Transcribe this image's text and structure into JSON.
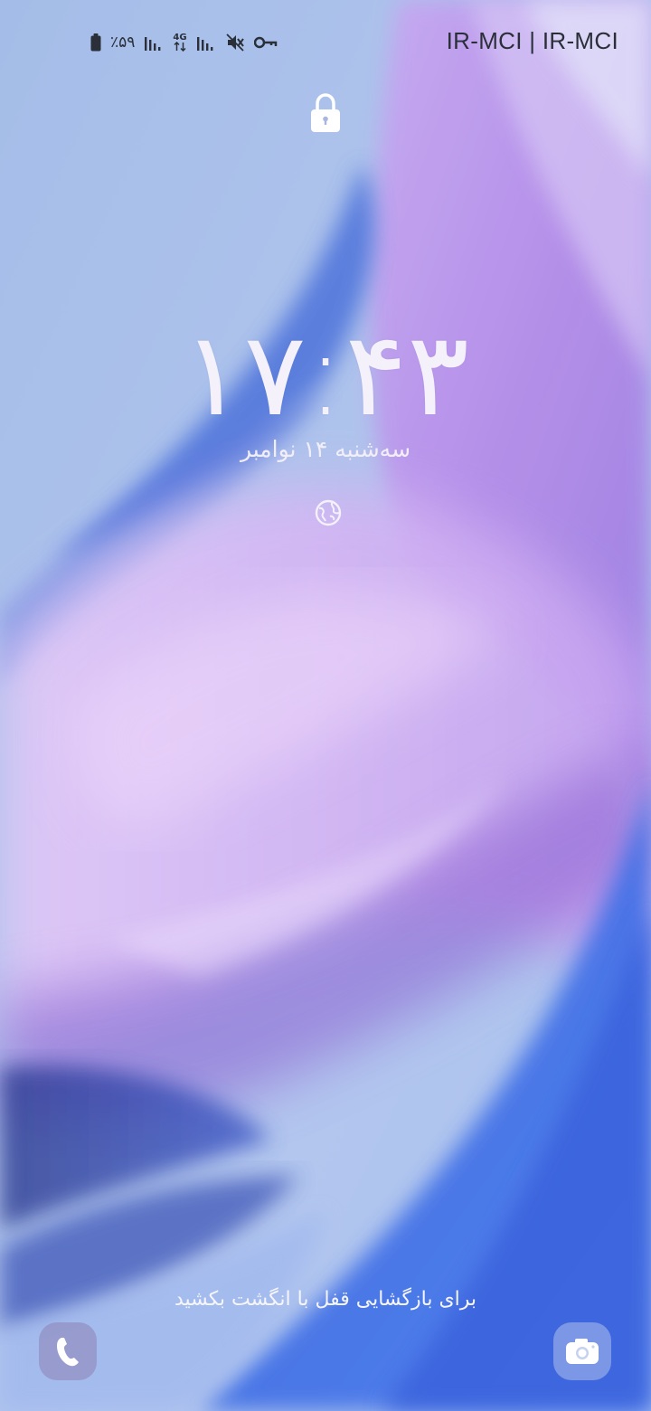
{
  "status_bar": {
    "battery_percent": "٪۵۹",
    "network_type": "4G",
    "carrier": "IR-MCI | IR-MCI",
    "icons": [
      "battery-icon",
      "signal-icon",
      "data-arrows-icon",
      "signal-icon",
      "mute-icon",
      "vpn-key-icon"
    ]
  },
  "lock_screen": {
    "lock_icon": "lock-icon",
    "time": "۱۷:۴۳",
    "date": "سه‌شنبه ۱۴ نوامبر",
    "weather_icon": "weather-globe-icon",
    "unlock_hint": "برای بازگشایی قفل با انگشت بکشید"
  },
  "shortcuts": {
    "left": "phone-icon",
    "right": "camera-icon"
  },
  "colors": {
    "text_light": "#f4f1fb",
    "status_text": "#2a2f3a",
    "wallpaper_base": "#a9c1ec"
  }
}
